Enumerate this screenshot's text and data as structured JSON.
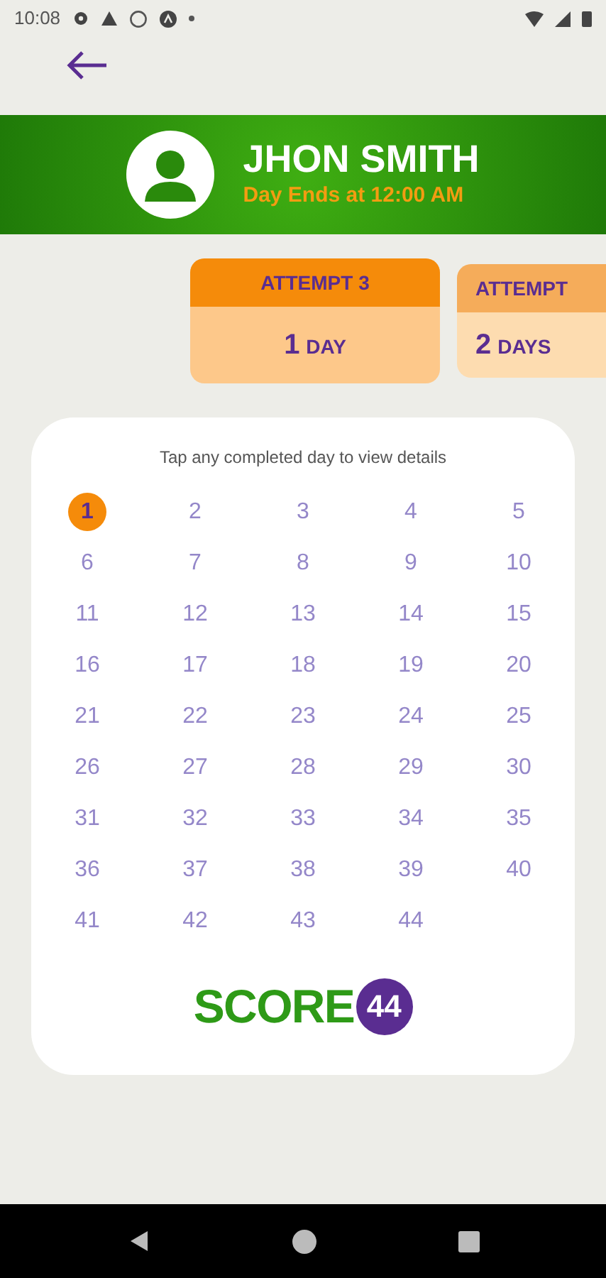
{
  "status_bar": {
    "time": "10:08"
  },
  "profile": {
    "name": "JHON SMITH",
    "subtitle": "Day Ends at 12:00 AM"
  },
  "attempts": [
    {
      "title": "ATTEMPT 3",
      "count": "1",
      "unit": "DAY",
      "selected": true
    },
    {
      "title": "ATTEMPT",
      "count": "2",
      "unit": "DAYS",
      "selected": false
    }
  ],
  "calendar": {
    "hint": "Tap any completed day to view details",
    "days": [
      {
        "label": "1",
        "selected": true
      },
      {
        "label": "2",
        "selected": false
      },
      {
        "label": "3",
        "selected": false
      },
      {
        "label": "4",
        "selected": false
      },
      {
        "label": "5",
        "selected": false
      },
      {
        "label": "6",
        "selected": false
      },
      {
        "label": "7",
        "selected": false
      },
      {
        "label": "8",
        "selected": false
      },
      {
        "label": "9",
        "selected": false
      },
      {
        "label": "10",
        "selected": false
      },
      {
        "label": "11",
        "selected": false
      },
      {
        "label": "12",
        "selected": false
      },
      {
        "label": "13",
        "selected": false
      },
      {
        "label": "14",
        "selected": false
      },
      {
        "label": "15",
        "selected": false
      },
      {
        "label": "16",
        "selected": false
      },
      {
        "label": "17",
        "selected": false
      },
      {
        "label": "18",
        "selected": false
      },
      {
        "label": "19",
        "selected": false
      },
      {
        "label": "20",
        "selected": false
      },
      {
        "label": "21",
        "selected": false
      },
      {
        "label": "22",
        "selected": false
      },
      {
        "label": "23",
        "selected": false
      },
      {
        "label": "24",
        "selected": false
      },
      {
        "label": "25",
        "selected": false
      },
      {
        "label": "26",
        "selected": false
      },
      {
        "label": "27",
        "selected": false
      },
      {
        "label": "28",
        "selected": false
      },
      {
        "label": "29",
        "selected": false
      },
      {
        "label": "30",
        "selected": false
      },
      {
        "label": "31",
        "selected": false
      },
      {
        "label": "32",
        "selected": false
      },
      {
        "label": "33",
        "selected": false
      },
      {
        "label": "34",
        "selected": false
      },
      {
        "label": "35",
        "selected": false
      },
      {
        "label": "36",
        "selected": false
      },
      {
        "label": "37",
        "selected": false
      },
      {
        "label": "38",
        "selected": false
      },
      {
        "label": "39",
        "selected": false
      },
      {
        "label": "40",
        "selected": false
      },
      {
        "label": "41",
        "selected": false
      },
      {
        "label": "42",
        "selected": false
      },
      {
        "label": "43",
        "selected": false
      },
      {
        "label": "44",
        "selected": false
      }
    ]
  },
  "logo": {
    "word": "SCORE",
    "number": "44"
  }
}
